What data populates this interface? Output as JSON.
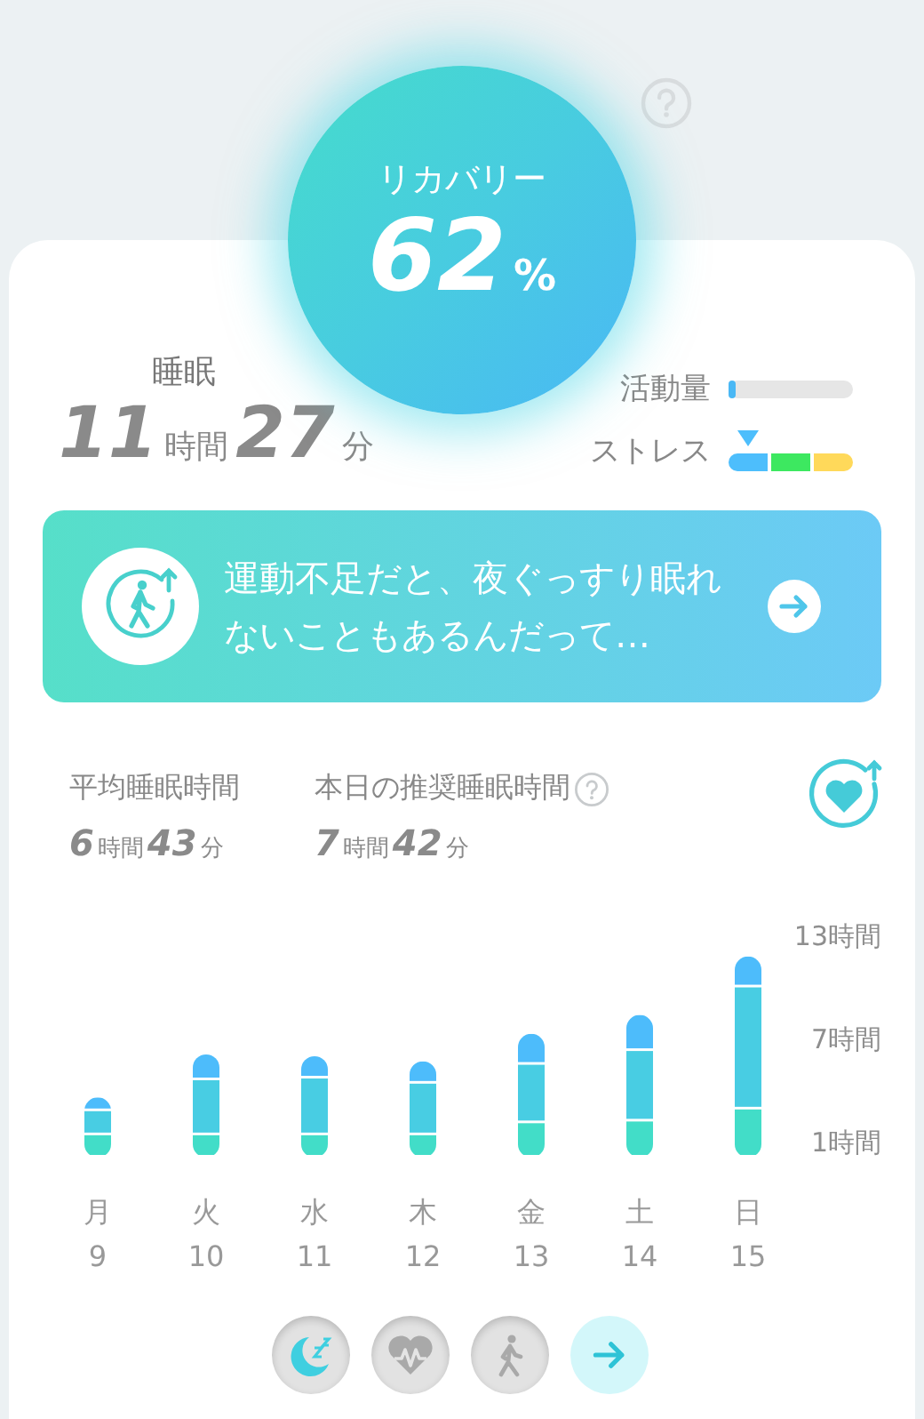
{
  "recovery": {
    "label": "リカバリー",
    "value": "62",
    "unit": "%"
  },
  "sleep": {
    "label": "睡眠",
    "hours": "11",
    "hours_unit": "時間",
    "minutes": "27",
    "minutes_unit": "分"
  },
  "activity": {
    "label": "活動量",
    "level": 0.05
  },
  "stress": {
    "label": "ストレス",
    "segments": [
      {
        "color": "#4dbefc"
      },
      {
        "color": "#3de860"
      },
      {
        "color": "#ffd95a"
      }
    ]
  },
  "banner": {
    "text": "運動不足だと、夜ぐっすり眠れないこともあるんだって…"
  },
  "stats": [
    {
      "label": "平均睡眠時間",
      "hours": "6",
      "hours_unit": "時間",
      "minutes": "43",
      "minutes_unit": "分"
    },
    {
      "label": "本日の推奨睡眠時間",
      "help": true,
      "hours": "7",
      "hours_unit": "時間",
      "minutes": "42",
      "minutes_unit": "分"
    }
  ],
  "chart": {
    "chart_data": {
      "type": "bar",
      "stacked": true,
      "categories": [
        "月",
        "火",
        "水",
        "木",
        "金",
        "土",
        "日"
      ],
      "series": [
        {
          "color": "#42ddc8",
          "values": [
            1.3,
            1.3,
            1.3,
            1.3,
            2.0,
            2.1,
            2.8
          ]
        },
        {
          "color": "#48cde3",
          "values": [
            1.4,
            3.2,
            3.3,
            3.0,
            3.4,
            4.1,
            7.1
          ]
        },
        {
          "color": "#4dbcfb",
          "values": [
            0.8,
            1.5,
            1.3,
            1.3,
            1.8,
            2.1,
            1.8
          ]
        }
      ],
      "ylim": [
        0,
        13
      ],
      "yticks": [
        {
          "value": 1,
          "label": "1時間"
        },
        {
          "value": 7,
          "label": "7時間"
        },
        {
          "value": 13,
          "label": "13時間"
        }
      ]
    },
    "dates": [
      "9",
      "10",
      "11",
      "12",
      "13",
      "14",
      "15"
    ]
  },
  "nav": [
    {
      "kind": "sleep",
      "selected": true
    },
    {
      "kind": "heart",
      "selected": false
    },
    {
      "kind": "walk",
      "selected": false
    },
    {
      "kind": "next",
      "selected": false
    }
  ]
}
